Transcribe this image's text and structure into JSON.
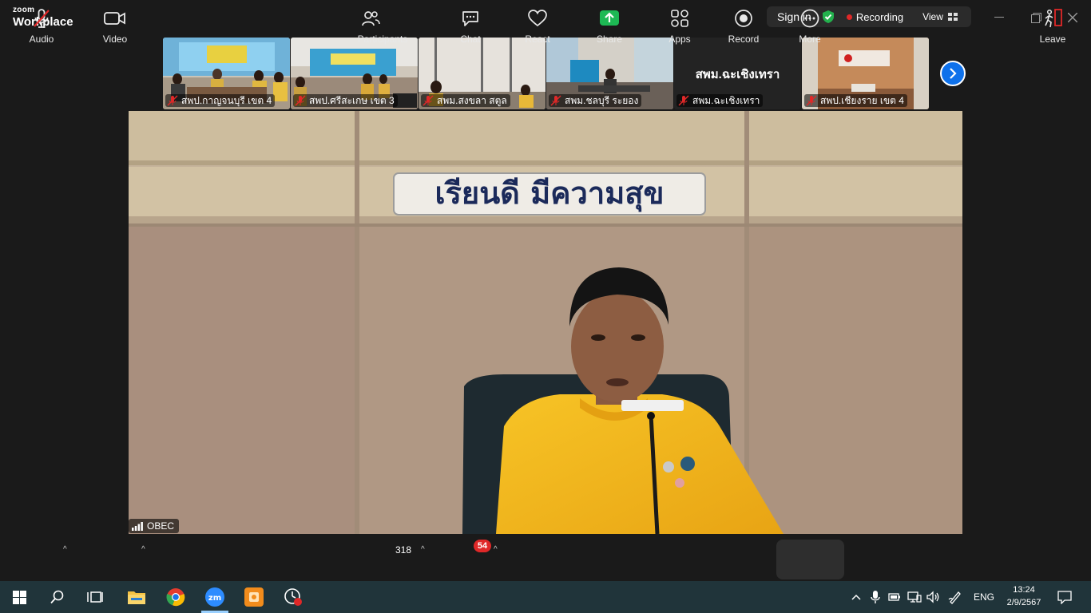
{
  "app": {
    "brand_top": "zoom",
    "brand_bottom": "Workplace"
  },
  "topbar": {
    "signin_label": "Sign in",
    "recording_label": "Recording",
    "view_label": "View"
  },
  "thumbnails": [
    {
      "name": "สพป.กาญจนบุรี เขต 4"
    },
    {
      "name": "สพป.ศรีสะเกษ เขต 3"
    },
    {
      "name": "สพม.สงขลา สตูล"
    },
    {
      "name": "สพม.ชลบุรี ระยอง"
    },
    {
      "name": "สพม.ฉะเชิงเทรา",
      "display": "สพม.ฉะเชิงเทรา"
    },
    {
      "name": "สพป.เชียงราย เขต 4"
    }
  ],
  "main_video": {
    "participant_name": "OBEC",
    "sign_text": "เรียนดี มีความสุข"
  },
  "toolbar": {
    "audio": "Audio",
    "video": "Video",
    "participants": "Participants",
    "participants_count": "318",
    "chat": "Chat",
    "chat_badge": "54",
    "react": "React",
    "share": "Share",
    "apps": "Apps",
    "record": "Record",
    "more": "More",
    "leave": "Leave"
  },
  "taskbar": {
    "language": "ENG",
    "time": "13:24",
    "date": "2/9/2567"
  },
  "colors": {
    "accent_blue": "#0e71eb",
    "share_green": "#1db954",
    "recording_red": "#e02828",
    "shirt_yellow": "#f2b51c"
  }
}
